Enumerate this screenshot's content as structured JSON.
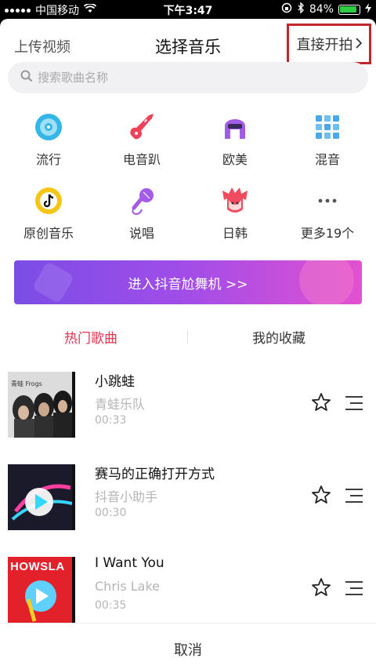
{
  "status_bar": {
    "carrier": "中国移动",
    "time": "下午3:47",
    "battery": "84%"
  },
  "header": {
    "upload_label": "上传视频",
    "title": "选择音乐",
    "direct_shoot_label": "直接开拍"
  },
  "search": {
    "placeholder": "搜索歌曲名称"
  },
  "categories": [
    {
      "label": "流行",
      "icon": "vinyl-icon",
      "color": "#34b6e6"
    },
    {
      "label": "电音趴",
      "icon": "electric-guitar-icon",
      "color": "#f0415a"
    },
    {
      "label": "欧美",
      "icon": "dj-headphones-icon",
      "color": "#a05be8"
    },
    {
      "label": "混音",
      "icon": "mixer-grid-icon",
      "color": "#4aa8e8"
    },
    {
      "label": "原创音乐",
      "icon": "tiktok-note-icon",
      "color": "#f5c518"
    },
    {
      "label": "说唱",
      "icon": "microphone-icon",
      "color": "#a45be8"
    },
    {
      "label": "日韩",
      "icon": "anime-hair-icon",
      "color": "#f04b5e"
    },
    {
      "label": "更多19个",
      "icon": "more-dots-icon",
      "color": "#666666"
    }
  ],
  "banner": {
    "label": "进入抖音尬舞机 >>"
  },
  "tabs": {
    "hot": "热门歌曲",
    "favorites": "我的收藏"
  },
  "songs": [
    {
      "title": "小跳蛙",
      "artist": "青蛙乐队",
      "duration": "00:33",
      "cover_text": "青蛙 Frogs"
    },
    {
      "title": "赛马的正确打开方式",
      "artist": "抖音小助手",
      "duration": "00:30",
      "cover_text": ""
    },
    {
      "title": "I Want You",
      "artist": "Chris Lake",
      "duration": "00:35",
      "cover_text": "HOWSLA"
    }
  ],
  "cancel_label": "取消",
  "colors": {
    "accent": "#e8334f",
    "highlight_box": "#c2262b"
  }
}
